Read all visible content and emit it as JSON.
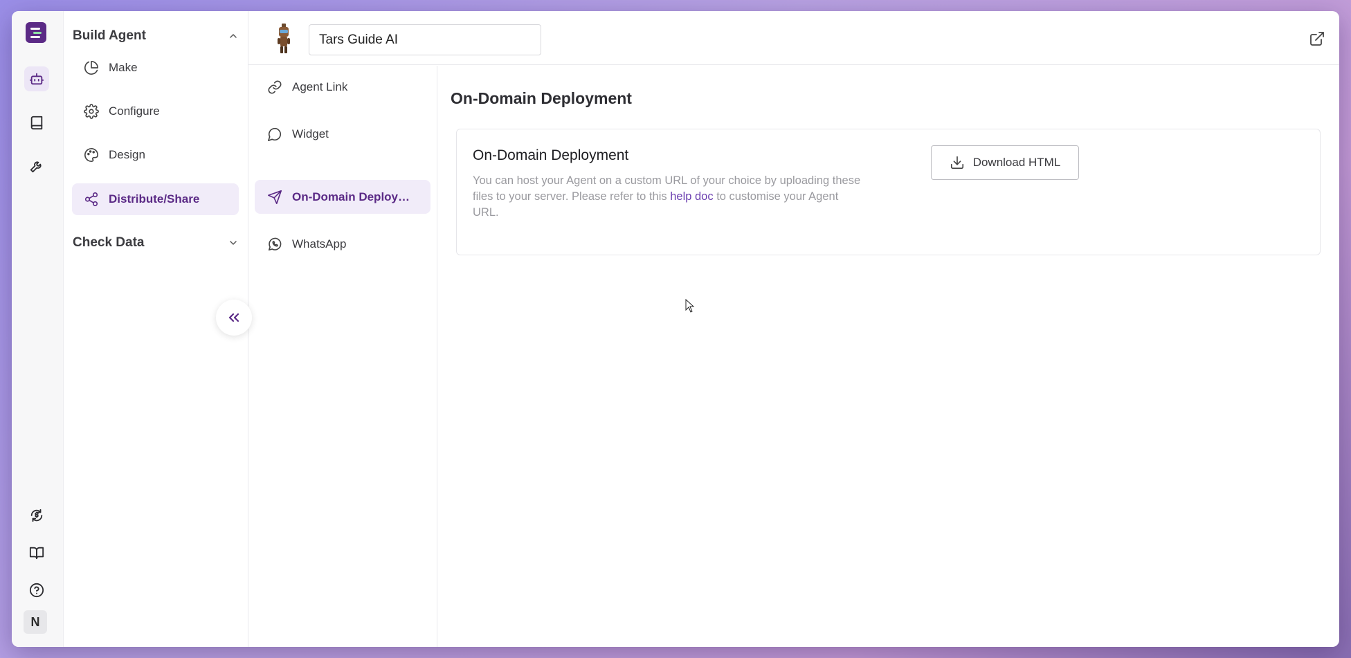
{
  "rail": {
    "icons": [
      "logo-icon",
      "bot-icon",
      "book-icon",
      "wrench-icon",
      "dollar-cycle-icon",
      "open-book-icon",
      "help-icon"
    ],
    "avatar_initial": "N"
  },
  "build_agent": {
    "title": "Build Agent",
    "items": [
      {
        "label": "Make",
        "icon": "pie-chart-icon"
      },
      {
        "label": "Configure",
        "icon": "gear-icon"
      },
      {
        "label": "Design",
        "icon": "palette-icon"
      },
      {
        "label": "Distribute/Share",
        "icon": "share-icon",
        "active": true
      }
    ]
  },
  "check_data": {
    "title": "Check Data"
  },
  "header": {
    "agent_name": "Tars Guide AI"
  },
  "subnav": {
    "items": [
      {
        "label": "Agent Link",
        "icon": "link-icon"
      },
      {
        "label": "Widget",
        "icon": "chat-bubble-icon"
      },
      {
        "label": "On-Domain Deployment",
        "icon": "send-icon",
        "active": true
      },
      {
        "label": "WhatsApp",
        "icon": "whatsapp-icon"
      }
    ]
  },
  "content": {
    "page_title": "On-Domain Deployment",
    "card": {
      "title": "On-Domain Deployment",
      "desc_before": "You can host your Agent on a custom URL of your choice by uploading these files to your server. Please refer to this ",
      "desc_link": "help doc",
      "desc_after": " to customise your Agent URL.",
      "button_label": "Download HTML"
    }
  },
  "colors": {
    "accent": "#5b2a86",
    "active_bg": "#f1ecf9",
    "link": "#6b3fb0"
  }
}
